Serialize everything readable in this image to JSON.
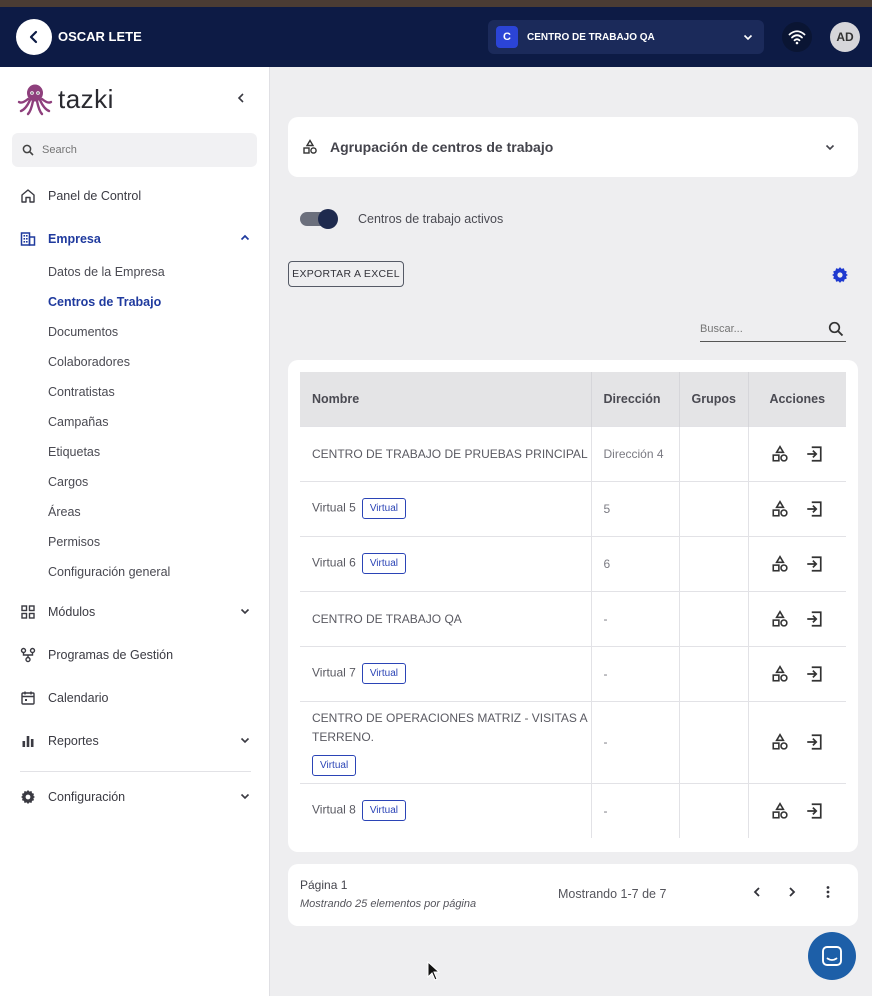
{
  "topbar": {
    "user_name": "OSCAR LETE",
    "center_badge": "C",
    "center_name": "CENTRO DE TRABAJO QA",
    "avatar_initials": "AD"
  },
  "sidebar": {
    "logo_text": "tazki",
    "search_placeholder": "Search",
    "items": [
      {
        "label": "Panel de Control",
        "icon": "home-icon"
      },
      {
        "label": "Empresa",
        "icon": "building-icon",
        "active": true
      },
      {
        "label": "Módulos",
        "icon": "grid-icon"
      },
      {
        "label": "Programas de Gestión",
        "icon": "flow-icon"
      },
      {
        "label": "Calendario",
        "icon": "calendar-icon"
      },
      {
        "label": "Reportes",
        "icon": "bar-chart-icon"
      },
      {
        "label": "Configuración",
        "icon": "gear-icon"
      }
    ],
    "sub_items": [
      "Datos de la Empresa",
      "Centros de Trabajo",
      "Documentos",
      "Colaboradores",
      "Contratistas",
      "Campañas",
      "Etiquetas",
      "Cargos",
      "Áreas",
      "Permisos",
      "Configuración general"
    ],
    "active_sub": "Centros de Trabajo"
  },
  "main": {
    "group_title": "Agrupación de centros de trabajo",
    "toggle_label": "Centros de trabajo activos",
    "toggle_on": true,
    "export_label": "EXPORTAR A EXCEL",
    "search_placeholder": "Buscar..."
  },
  "table": {
    "headers": [
      "Nombre",
      "Dirección",
      "Grupos",
      "Acciones"
    ],
    "virtual_label": "Virtual",
    "rows": [
      {
        "name": "CENTRO DE TRABAJO DE PRUEBAS PRINCIPAL",
        "virtual": false,
        "direccion": "Dirección 4",
        "grupos": ""
      },
      {
        "name": "Virtual 5",
        "virtual": true,
        "direccion": "5",
        "grupos": ""
      },
      {
        "name": "Virtual 6",
        "virtual": true,
        "direccion": "6",
        "grupos": ""
      },
      {
        "name": "CENTRO DE TRABAJO QA",
        "virtual": false,
        "direccion": "-",
        "grupos": ""
      },
      {
        "name": "Virtual 7",
        "virtual": true,
        "direccion": "-",
        "grupos": ""
      },
      {
        "name": "CENTRO DE OPERACIONES MATRIZ - VISITAS A TERRENO.",
        "virtual": true,
        "direccion": "-",
        "grupos": ""
      },
      {
        "name": "Virtual 8",
        "virtual": true,
        "direccion": "-",
        "grupos": ""
      }
    ]
  },
  "pagination": {
    "page": "Página 1",
    "per_page": "Mostrando 25 elementos por página",
    "showing": "Mostrando 1-7 de 7"
  },
  "colors": {
    "topbar": "#0d1b45",
    "accent": "#1f3a9e",
    "badge": "#2b44d6",
    "chat": "#1d5fa8"
  }
}
